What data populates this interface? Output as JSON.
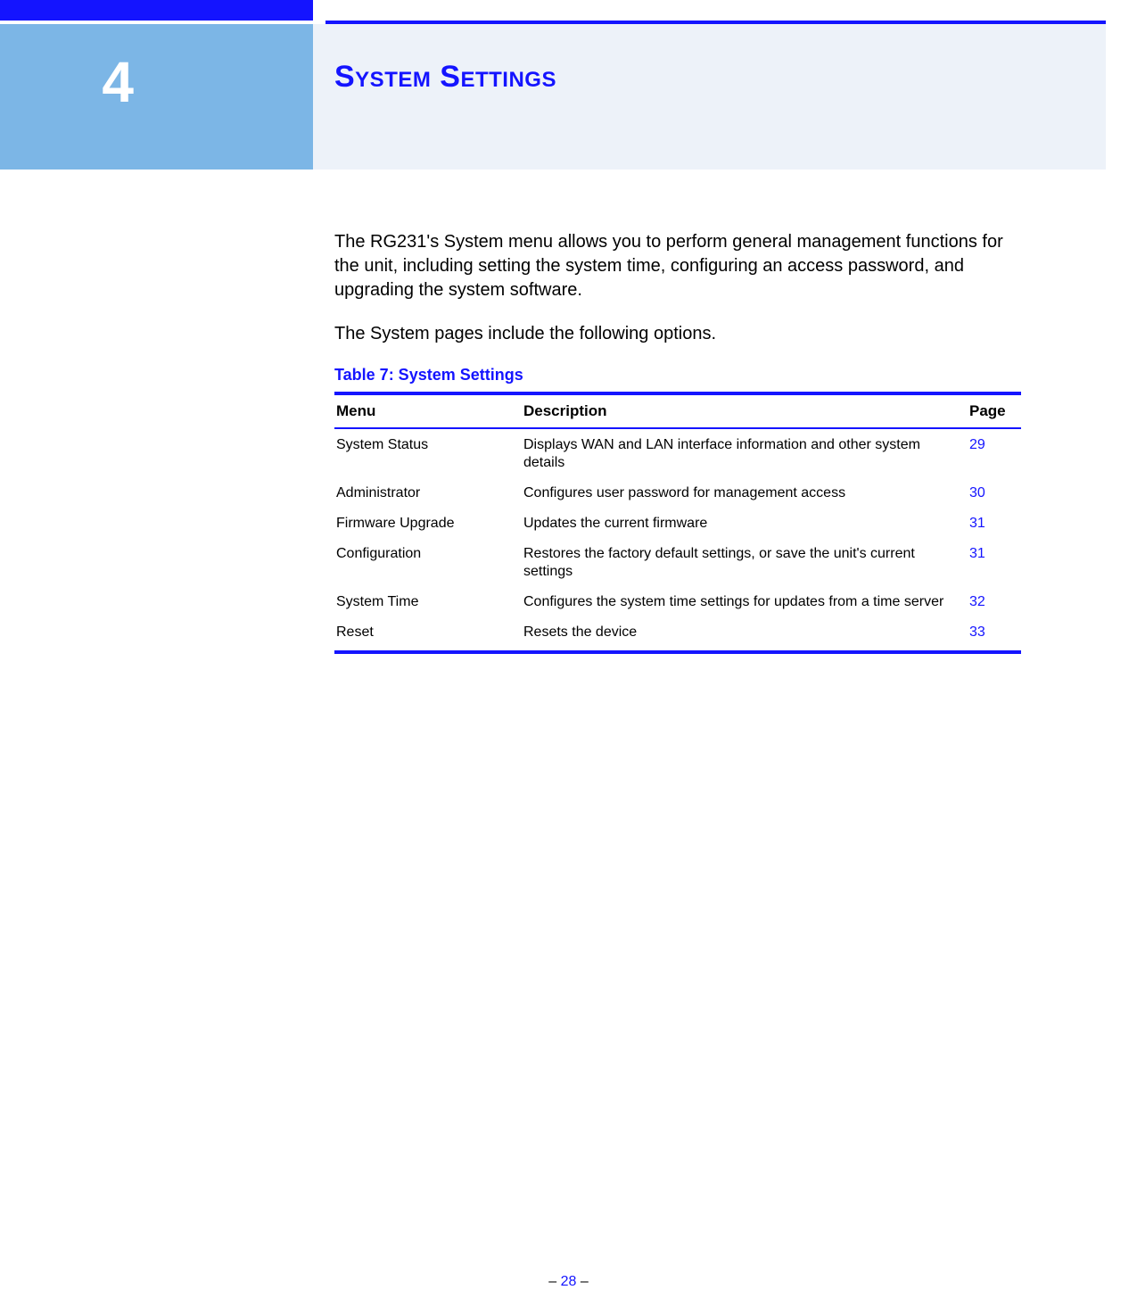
{
  "chapter": {
    "number": "4",
    "title": "System Settings"
  },
  "paragraphs": {
    "p1": "The RG231's System menu allows you to perform general management functions for the unit, including setting the system time, configuring an access password, and upgrading the system software.",
    "p2": "The System pages include the following options."
  },
  "table": {
    "caption": "Table 7: System Settings",
    "headers": {
      "menu": "Menu",
      "description": "Description",
      "page": "Page"
    },
    "rows": [
      {
        "menu": "System Status",
        "description": "Displays WAN and LAN interface information and other system details",
        "page": "29"
      },
      {
        "menu": "Administrator",
        "description": "Configures user password for management access",
        "page": "30"
      },
      {
        "menu": "Firmware Upgrade",
        "description": "Updates the current firmware",
        "page": "31"
      },
      {
        "menu": "Configuration",
        "description": "Restores the factory default settings, or save the unit's current settings",
        "page": "31"
      },
      {
        "menu": "System Time",
        "description": "Configures the system time settings for updates from a time server",
        "page": "32"
      },
      {
        "menu": "Reset",
        "description": "Resets the device",
        "page": "33"
      }
    ]
  },
  "footer": {
    "dash_left": "–  ",
    "page_number": "28",
    "dash_right": "  –"
  }
}
